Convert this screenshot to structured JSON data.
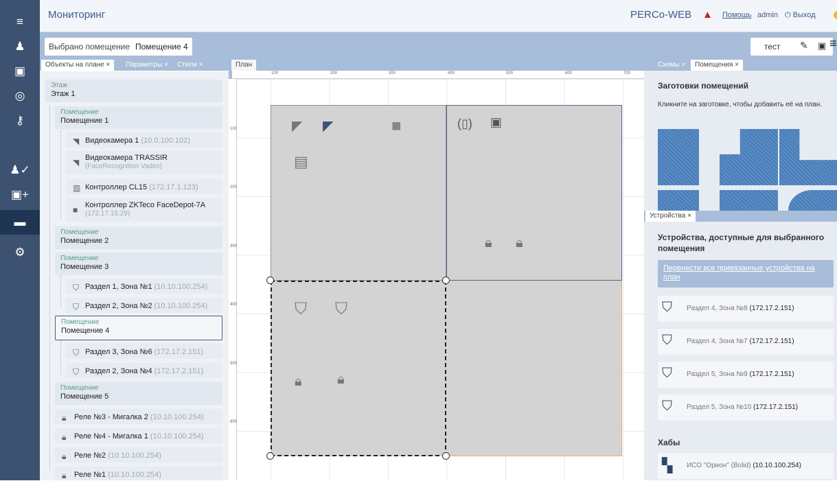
{
  "rail": {
    "items": [
      {
        "name": "menu-icon",
        "glyph": "≡"
      },
      {
        "name": "person-icon",
        "glyph": "👤"
      },
      {
        "name": "id-card-icon",
        "glyph": "▣"
      },
      {
        "name": "globe-person-icon",
        "glyph": "◎"
      },
      {
        "name": "key-icon",
        "glyph": "🔑"
      },
      {
        "name": "person-check-icon",
        "glyph": "✔"
      },
      {
        "name": "card-add-icon",
        "glyph": "+"
      },
      {
        "name": "monitor-icon",
        "glyph": "▬"
      },
      {
        "name": "gear-icon",
        "glyph": "⚙"
      }
    ]
  },
  "header": {
    "title": "Мониторинг",
    "brand": "PERCo-WEB",
    "help": "Помощь",
    "user": "admin",
    "logout": "Выход"
  },
  "crumb": {
    "label": "Выбрано помещение",
    "value": "Помещение 4",
    "scheme": "тест"
  },
  "left_tabs": [
    "Объекты на плане",
    "Параметры",
    "Стили"
  ],
  "tree": {
    "floor": {
      "k": "Этаж",
      "v": "Этаж 1"
    },
    "room_k": "Помещение",
    "rooms": [
      "Помещение 1",
      "Помещение 2",
      "Помещение 3",
      "Помещение 4",
      "Помещение 5"
    ],
    "devs": [
      {
        "n": "Видеокамера 1",
        "ip": "(10.0.100.102)"
      },
      {
        "n": "Видеокамера TRASSIR",
        "ip": "(FaceRecognition Vadim)"
      },
      {
        "n": "Контроллер CL15",
        "ip": "(172.17.1.123)"
      },
      {
        "n": "Контроллер ZKTeco FaceDepot-7A",
        "ip": "(172.17.15.29)"
      },
      {
        "n": "Раздел 1, Зона №1",
        "ip": "(10.10.100.254)"
      },
      {
        "n": "Раздел 2, Зона №2",
        "ip": "(10.10.100.254)"
      },
      {
        "n": "Раздел 3, Зона №6",
        "ip": "(172.17.2.151)"
      },
      {
        "n": "Раздел 2, Зона №4",
        "ip": "(172.17.2.151)"
      },
      {
        "n": "Реле №3 - Мигалка 2",
        "ip": "(10.10.100.254)"
      },
      {
        "n": "Реле №4 - Мигалка 1",
        "ip": "(10.10.100.254)"
      },
      {
        "n": "Реле №2",
        "ip": "(10.10.100.254)"
      },
      {
        "n": "Реле №1",
        "ip": "(10.10.100.254)"
      }
    ]
  },
  "plan": {
    "tab": "План",
    "ruler_x": [
      "100",
      "200",
      "300",
      "400",
      "500",
      "600",
      "700"
    ],
    "ruler_y": [
      "100",
      "200",
      "300",
      "400",
      "500",
      "600"
    ]
  },
  "right_tabs": [
    "Схемы",
    "Помещения"
  ],
  "templates": {
    "title": "Заготовки помещений",
    "hint": "Кликните на заготовке, чтобы добавить её на план."
  },
  "devices": {
    "tab": "Устройства",
    "title": "Устройства, доступные для выбранного помещения",
    "move": "Перенести все привязанные устройства на план",
    "zones": [
      {
        "n": "Раздел 4, Зона №8",
        "ip": "(172.17.2.151)"
      },
      {
        "n": "Раздел 4, Зона №7",
        "ip": "(172.17.2.151)"
      },
      {
        "n": "Раздел 5, Зона №9",
        "ip": "(172.17.2.151)"
      },
      {
        "n": "Раздел 5, Зона №10",
        "ip": "(172.17.2.151)"
      }
    ],
    "hubs_title": "Хабы",
    "hub": {
      "n": "ИСО \"Орион\" (Bolid)",
      "ip": "(10.10.100.254)"
    }
  },
  "colors": {
    "rail": "#3d5170",
    "panel": "#a7bdd9",
    "accent": "#3d5c8a",
    "room": "#d3d3d3"
  }
}
